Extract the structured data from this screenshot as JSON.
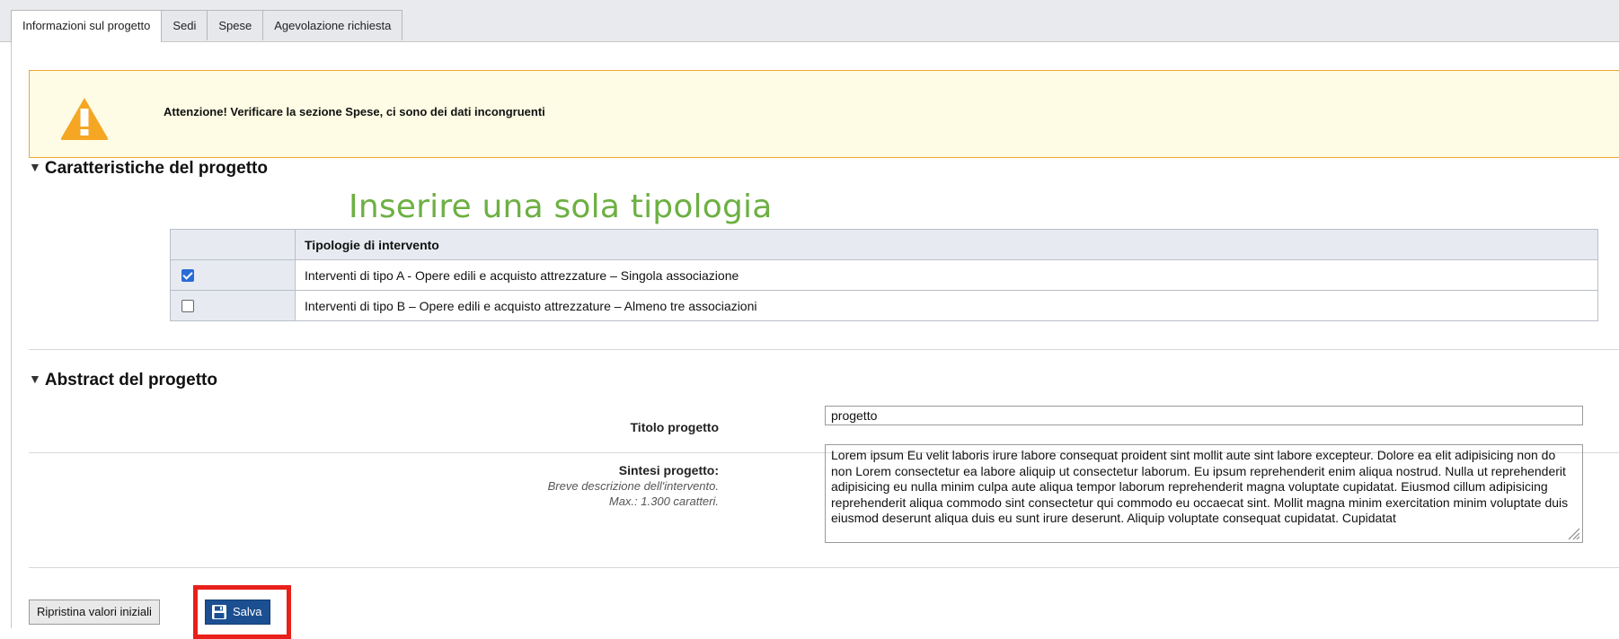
{
  "tabs": [
    {
      "label": "Informazioni sul progetto",
      "active": true
    },
    {
      "label": "Sedi",
      "active": false
    },
    {
      "label": "Spese",
      "active": false
    },
    {
      "label": "Agevolazione richiesta",
      "active": false
    }
  ],
  "warning": {
    "icon": "warning-icon",
    "text": "Attenzione! Verificare la sezione Spese, ci sono dei dati incongruenti",
    "border_color": "#f1a630"
  },
  "characteristics": {
    "title": "Caratteristiche del progetto",
    "annotation": "Inserire una sola tipologia",
    "annotation_color": "#6db043",
    "table_header": "Tipologie di intervento",
    "rows": [
      {
        "checked": true,
        "label": "Interventi di tipo A - Opere edili e acquisto attrezzature – Singola associazione"
      },
      {
        "checked": false,
        "label": "Interventi di tipo B – Opere edili e acquisto attrezzature – Almeno tre associazioni"
      }
    ]
  },
  "abstract": {
    "title": "Abstract del progetto",
    "title_field": {
      "label": "Titolo progetto",
      "value": "progetto"
    },
    "summary_field": {
      "label": "Sintesi progetto:",
      "hint": "Breve descrizione dell'intervento.",
      "max": "Max.: 1.300 caratteri.",
      "value": "Lorem ipsum Eu velit laboris irure labore consequat proident sint mollit aute sint labore excepteur. Dolore ea elit adipisicing non do non Lorem consectetur ea labore aliquip ut consectetur laborum. Eu ipsum reprehenderit enim aliqua nostrud. Nulla ut reprehenderit adipisicing eu nulla minim culpa aute aliqua tempor laborum reprehenderit magna voluptate cupidatat. Eiusmod cillum adipisicing reprehenderit aliqua commodo sint consectetur qui commodo eu occaecat sint. Mollit magna minim exercitation minim voluptate duis eiusmod deserunt aliqua duis eu sunt irure deserunt. Aliquip voluptate consequat cupidatat. Cupidatat"
    }
  },
  "buttons": {
    "reset": "Ripristina valori iniziali",
    "save": "Salva",
    "save_icon": "floppy-disk-icon",
    "highlight_color": "#e8201a"
  }
}
